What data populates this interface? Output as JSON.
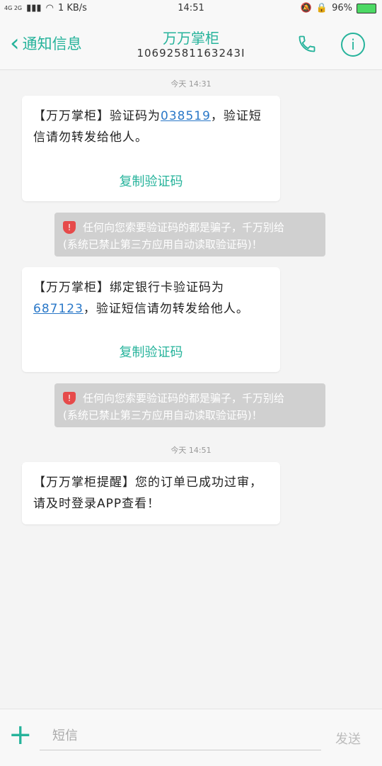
{
  "status_bar": {
    "network": "4G 2G",
    "speed": "1 KB/s",
    "time": "14:51",
    "battery": "96%"
  },
  "header": {
    "back_label": "通知信息",
    "contact_name": "万万掌柜",
    "contact_number": "10692581163243I"
  },
  "messages": {
    "time1": "今天 14:31",
    "m1_prefix": "【万万掌柜】验证码为",
    "m1_code": "038519",
    "m1_suffix": "，验证短信请勿转发给他人。",
    "copy_label_1": "复制验证码",
    "warn1_line1": "任何向您索要验证码的都是骗子，千万别给",
    "warn1_line2": "(系统已禁止第三方应用自动读取验证码)！",
    "m2_prefix": "【万万掌柜】绑定银行卡验证码为",
    "m2_code": "687123",
    "m2_suffix": "，验证短信请勿转发给他人。",
    "copy_label_2": "复制验证码",
    "warn2_line1": "任何向您索要验证码的都是骗子，千万别给",
    "warn2_line2": "(系统已禁止第三方应用自动读取验证码)！",
    "time2": "今天 14:51",
    "m3_text": "【万万掌柜提醒】您的订单已成功过审，请及时登录APP查看！"
  },
  "input": {
    "placeholder": "短信",
    "send_label": "发送"
  },
  "colors": {
    "accent": "#26b39b",
    "link": "#2a78c8",
    "warning_bg": "#d0d0d0"
  }
}
